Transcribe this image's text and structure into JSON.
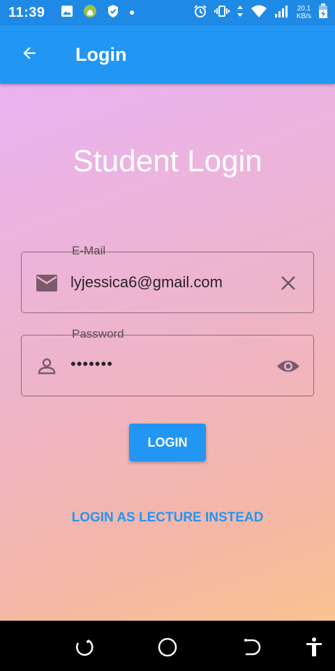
{
  "status_bar": {
    "time": "11:39",
    "net_speed_value": "20.1",
    "net_speed_unit": "KB/s"
  },
  "app_bar": {
    "title": "Login"
  },
  "main": {
    "heading": "Student Login",
    "email": {
      "label": "E-Mail",
      "value": "lyjessica6@gmail.com"
    },
    "password": {
      "label": "Password",
      "value": "•••••••"
    },
    "login_label": "LOGIN",
    "alt_login_label": "LOGIN AS LECTURE INSTEAD"
  },
  "colors": {
    "primary": "#2196f3",
    "status_bar": "#1f8ae6",
    "gradient_start": "#e9b3f2",
    "gradient_end": "#fac291"
  }
}
